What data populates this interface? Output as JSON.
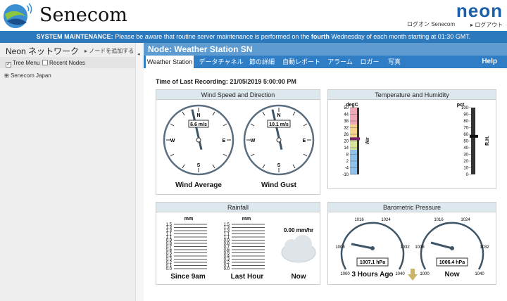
{
  "header": {
    "brand": "Senecom",
    "neon_logo": "neon",
    "login_status": "ログオン Senecom",
    "logout": "ログアウト"
  },
  "maintenance": {
    "label": "SYSTEM MAINTENANCE:",
    "text_before": " Please be aware that routine server maintenance is performed on the ",
    "emph": "fourth",
    "text_after": " Wednesday of each month starting at 01:30 GMT."
  },
  "sidebar": {
    "title": "Neon ネットワーク",
    "add_node": "ノードを追加する",
    "tree_menu": "Tree Menu",
    "recent_nodes": "Recent Nodes",
    "tree_item": "Senecom Japan"
  },
  "node_title": "Node: Weather Station SN",
  "tabs": [
    "Weather Station",
    "データチャネル",
    "節の詳細",
    "自動レポート",
    "アラーム",
    "ロガー",
    "写真"
  ],
  "help": "Help",
  "last_recording": "Time of Last Recording: 21/05/2019 5:00:00 PM",
  "wind": {
    "title": "Wind Speed and Direction",
    "average": {
      "label": "Wind Average",
      "value": "6.6 m/s"
    },
    "gust": {
      "label": "Wind Gust",
      "value": "10.1 m/s"
    },
    "directions": [
      "N",
      "E",
      "S",
      "W"
    ]
  },
  "temp": {
    "title": "Temperature and Humidity",
    "unit_temp": "degC",
    "unit_rh": "pct",
    "temp_label": "Air",
    "rh_label": "R.H.",
    "temp_ticks": [
      "50",
      "44",
      "38",
      "32",
      "26",
      "20",
      "14",
      "8",
      "2",
      "-4",
      "-10"
    ],
    "rh_ticks": [
      "100",
      "90",
      "80",
      "70",
      "60",
      "50",
      "40",
      "30",
      "20",
      "10",
      "0"
    ],
    "air_temp_value": 22,
    "rh_value": 57
  },
  "rain": {
    "title": "Rainfall",
    "unit": "mm",
    "ticks": [
      "1.5",
      "1.3",
      "1.3",
      "1.1",
      "1.1",
      "0.9",
      "0.8",
      "0.7",
      "0.6",
      "0.5",
      "0.4",
      "0.3",
      "0.2",
      "0.1",
      "0.0"
    ],
    "since_9am_label": "Since 9am",
    "last_hour_label": "Last Hour",
    "now_label": "Now",
    "rate": "0.00 mm/hr"
  },
  "pressure": {
    "title": "Barometric Pressure",
    "ticks": [
      "1000",
      "1008",
      "1016",
      "1024",
      "1032",
      "1040"
    ],
    "three_hours_label": "3 Hours Ago",
    "three_hours_value": "1007.1 hPa",
    "now_label": "Now",
    "now_value": "1006.4 hPa"
  }
}
